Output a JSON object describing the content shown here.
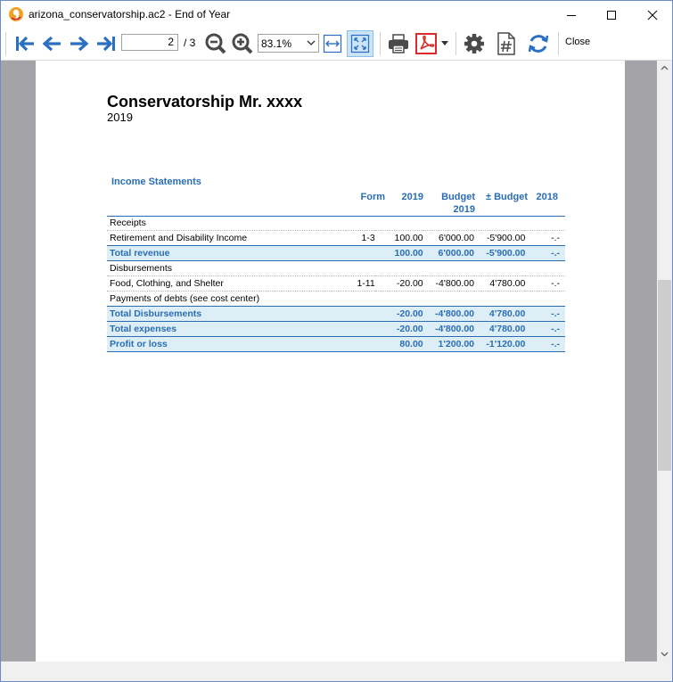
{
  "window": {
    "title": "arizona_conservatorship.ac2 - End of Year"
  },
  "toolbar": {
    "page_current": "2",
    "page_total": "/ 3",
    "zoom": "83.1%",
    "close_label": "Close"
  },
  "document": {
    "title": "Conservatorship Mr. xxxx",
    "year": "2019",
    "report_title": "Income Statements",
    "columns": {
      "form": "Form",
      "year": "2019",
      "budget": "Budget",
      "budget_year": "2019",
      "delta": "± Budget",
      "prior": "2018"
    },
    "rows": [
      {
        "type": "section",
        "description": "Receipts"
      },
      {
        "type": "item",
        "description": "Retirement and Disability Income",
        "form": "1-3",
        "year": "100.00",
        "budget": "6'000.00",
        "delta": "-5'900.00",
        "prior": "-.-"
      },
      {
        "type": "total",
        "description": "Total revenue",
        "form": "",
        "year": "100.00",
        "budget": "6'000.00",
        "delta": "-5'900.00",
        "prior": "-.-"
      },
      {
        "type": "section",
        "description": "Disbursements"
      },
      {
        "type": "item",
        "description": "Food, Clothing, and Shelter",
        "form": "1-11",
        "year": "-20.00",
        "budget": "-4'800.00",
        "delta": "4'780.00",
        "prior": "-.-"
      },
      {
        "type": "section",
        "description": "Payments of debts (see cost center)"
      },
      {
        "type": "total",
        "description": "Total Disbursements",
        "form": "",
        "year": "-20.00",
        "budget": "-4'800.00",
        "delta": "4'780.00",
        "prior": "-.-"
      },
      {
        "type": "total",
        "description": "Total expenses",
        "form": "",
        "year": "-20.00",
        "budget": "-4'800.00",
        "delta": "4'780.00",
        "prior": "-.-"
      },
      {
        "type": "total",
        "description": "Profit or loss",
        "form": "",
        "year": "80.00",
        "budget": "1'200.00",
        "delta": "-1'120.00",
        "prior": "-.-"
      }
    ]
  },
  "colors": {
    "accent": "#2a6db5",
    "total_row_bg": "#deeef6",
    "viewer_bg": "#a3a3a8",
    "nav_arrow": "#2b6fc4",
    "pdf_red": "#d92b2b"
  }
}
